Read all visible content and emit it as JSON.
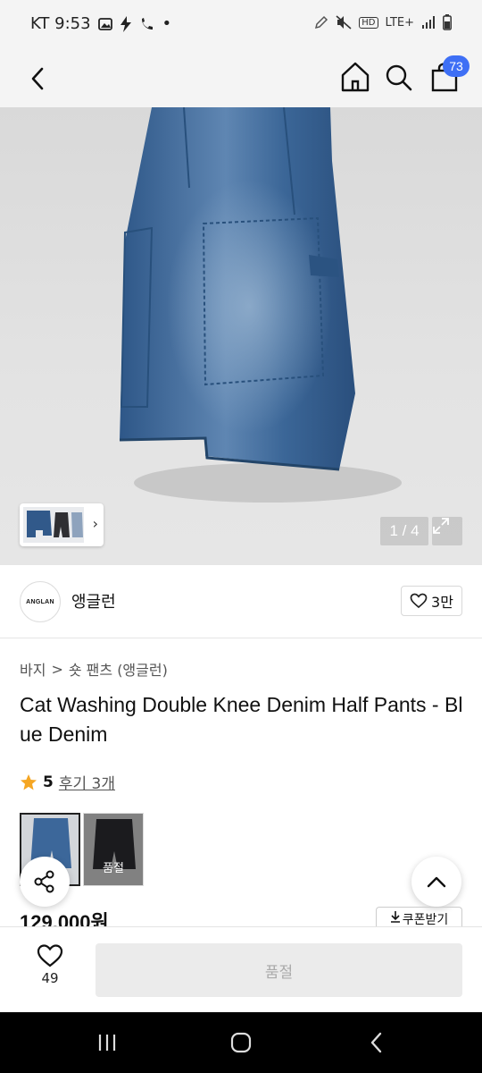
{
  "status_bar": {
    "carrier_time": "KT 9:53",
    "dot": "•",
    "network": "LTE+",
    "hd_label": "HD"
  },
  "header": {
    "back_icon": "chevron-left-icon",
    "home_icon": "home-icon",
    "search_icon": "search-icon",
    "cart_icon": "shopping-bag-icon",
    "cart_count": "73"
  },
  "gallery": {
    "counter": "1 / 4",
    "thumb_chevron": "›",
    "expand_icon": "expand-icon"
  },
  "brand": {
    "logo_text": "ANGLAN",
    "name": "앵글런",
    "like_count": "3만"
  },
  "breadcrumb": {
    "category": "바지",
    "separator": ">",
    "subcategory": "숏 팬츠 (앵글런)"
  },
  "product": {
    "title": "Cat Washing Double Knee Denim Half Pants - Blue Denim",
    "rating": "5",
    "reviews": "후기 3개",
    "soldout_label": "품절",
    "price": "129,000원",
    "coupon_label": "쿠폰받기"
  },
  "action_bar": {
    "wish_count": "49",
    "buy_label": "품절"
  },
  "colors": {
    "accent": "#3e6ff5",
    "star": "#f5a623",
    "denim": "#3f6d9e"
  }
}
